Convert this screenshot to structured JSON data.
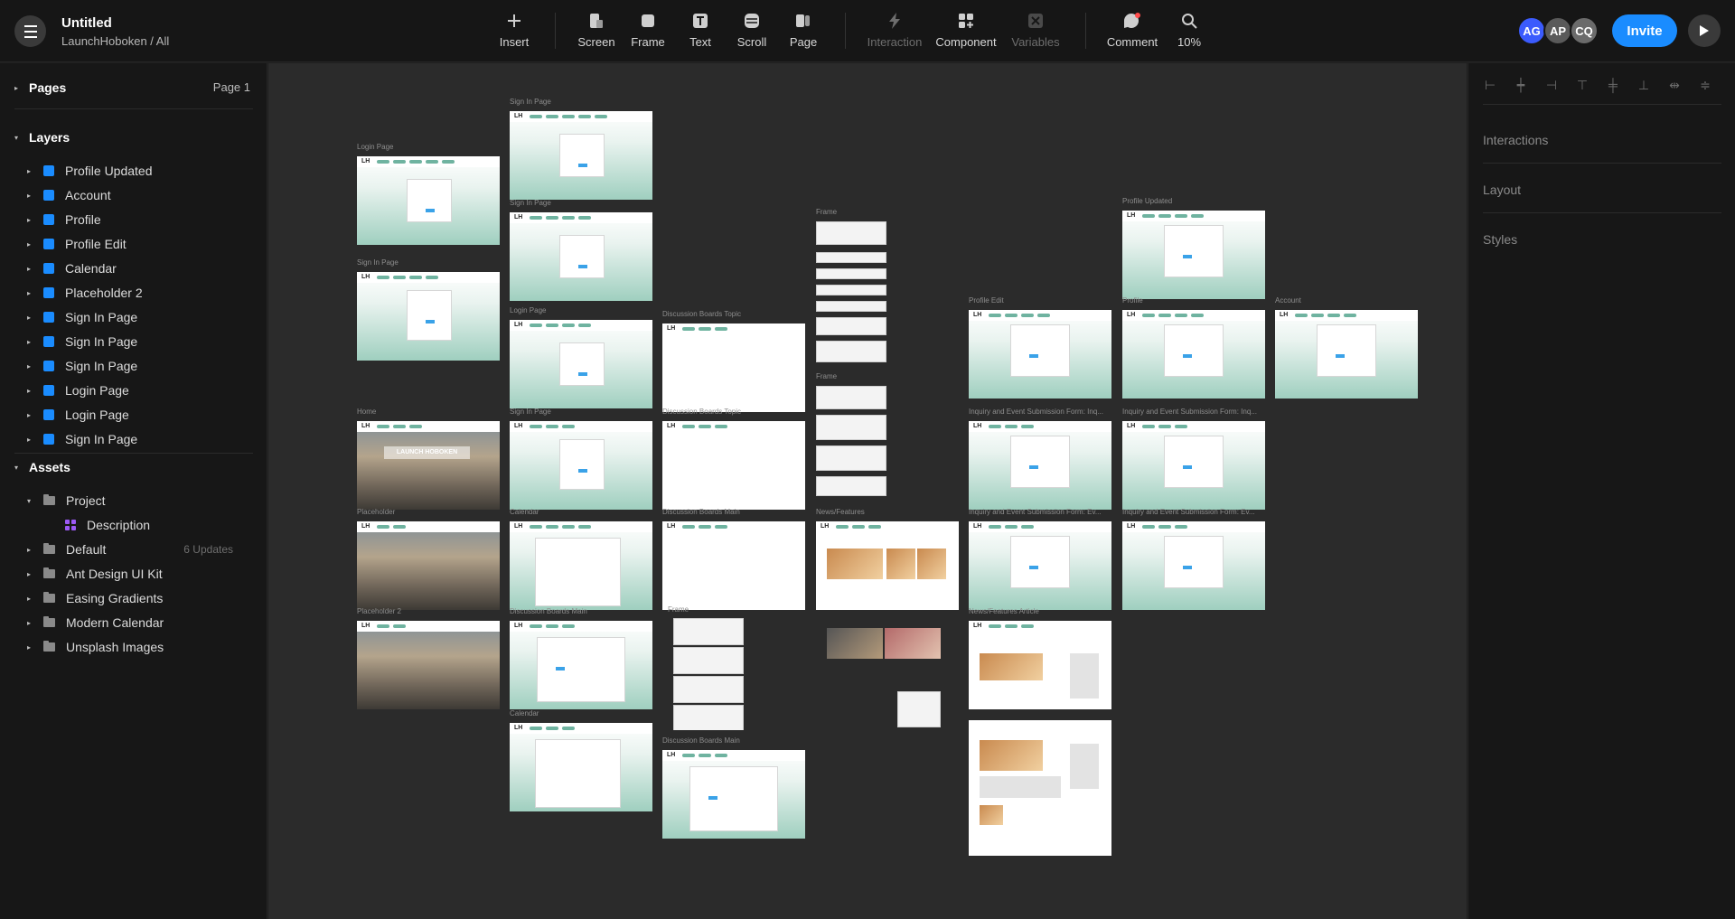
{
  "header": {
    "file_title": "Untitled",
    "file_path": "LaunchHoboken / All",
    "tools": [
      {
        "label": "Insert",
        "icon": "plus-icon"
      },
      {
        "label": "Screen",
        "icon": "screen-icon"
      },
      {
        "label": "Frame",
        "icon": "frame-icon"
      },
      {
        "label": "Text",
        "icon": "text-icon"
      },
      {
        "label": "Scroll",
        "icon": "scroll-icon"
      },
      {
        "label": "Page",
        "icon": "page-icon"
      },
      {
        "label": "Interaction",
        "icon": "lightning-icon"
      },
      {
        "label": "Component",
        "icon": "component-icon"
      },
      {
        "label": "Variables",
        "icon": "variables-icon"
      },
      {
        "label": "Comment",
        "icon": "comment-icon"
      },
      {
        "label": "10%",
        "icon": "zoom-icon"
      }
    ],
    "avatars": [
      {
        "initials": "AG",
        "color": "#3b5bfd"
      },
      {
        "initials": "AP",
        "color": "#5a5a5a"
      },
      {
        "initials": "CQ",
        "color": "#6b6b6b"
      }
    ],
    "invite_label": "Invite",
    "accent": "#1a8cff"
  },
  "sidebar": {
    "pages_title": "Pages",
    "current_page": "Page 1",
    "layers_title": "Layers",
    "layers": [
      "Profile Updated",
      "Account",
      "Profile",
      "Profile Edit",
      "Calendar",
      "Placeholder 2",
      "Sign In Page",
      "Sign In Page",
      "Sign In Page",
      "Login Page",
      "Login Page",
      "Sign In Page"
    ],
    "assets_title": "Assets",
    "assets": [
      {
        "label": "Project",
        "kind": "folder",
        "expanded": true
      },
      {
        "label": "Description",
        "kind": "component"
      },
      {
        "label": "Default",
        "kind": "folder",
        "note": "6 Updates"
      },
      {
        "label": "Ant Design UI Kit",
        "kind": "folder"
      },
      {
        "label": "Easing Gradients",
        "kind": "folder"
      },
      {
        "label": "Modern Calendar",
        "kind": "folder"
      },
      {
        "label": "Unsplash Images",
        "kind": "folder"
      }
    ]
  },
  "canvas": {
    "frame_labels": {
      "login_page": "Login Page",
      "sign_in_page": "Sign In Page",
      "frame": "Frame",
      "profile_updated": "Profile Updated",
      "profile_edit": "Profile Edit",
      "profile": "Profile",
      "account": "Account",
      "home": "Home",
      "placeholder": "Placeholder",
      "placeholder2": "Placeholder 2",
      "calendar": "Calendar",
      "discussion_topic": "Discussion Boards Topic",
      "discussion_main": "Discussion Boards Main",
      "news": "News/Features",
      "news_article": "News/Features Article",
      "inquiry": "Inquiry and Event Submission Form: Inq...",
      "inquiry_ev": "Inquiry and Event Submission Form: Ev..."
    },
    "brand": "LH",
    "home_banner": "LAUNCH HOBOKEN"
  },
  "right_panel": {
    "interactions_title": "Interactions",
    "layout_title": "Layout",
    "styles_title": "Styles"
  }
}
